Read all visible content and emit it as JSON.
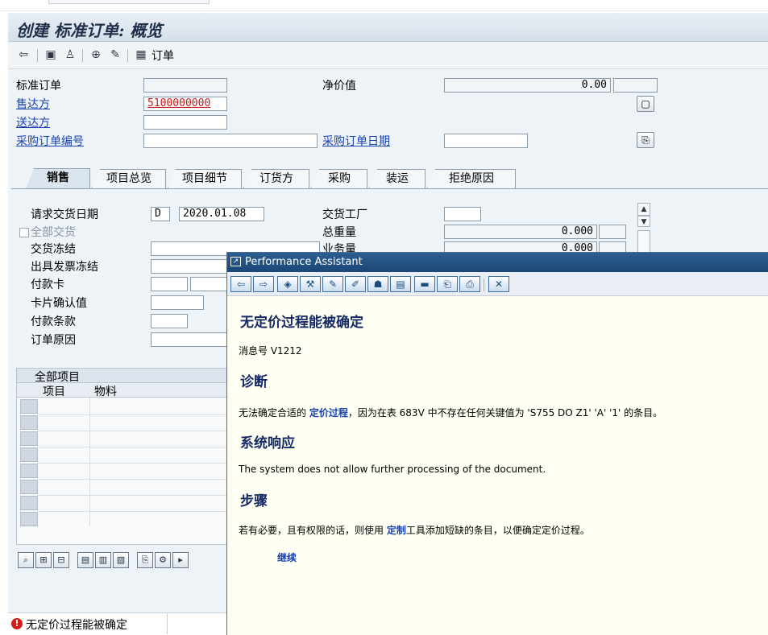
{
  "window": {
    "title": "创建 标准订单: 概览"
  },
  "toolbar": {
    "icons": [
      "back-icon",
      "save-icon",
      "user-icon",
      "display-icon",
      "edit-icon",
      "grid-icon"
    ],
    "order_label": "订单"
  },
  "header": {
    "order_type_label": "标准订单",
    "order_type_value": "",
    "sold_to_label": "售达方",
    "sold_to_value": "5100000000",
    "ship_to_label": "送达方",
    "ship_to_value": "",
    "po_number_label": "采购订单编号",
    "po_number_value": "",
    "net_value_label": "净价值",
    "net_value": "0.00",
    "net_value_currency": "",
    "po_date_label": "采购订单日期",
    "po_date_value": ""
  },
  "tabs": [
    {
      "label": "销售",
      "active": true
    },
    {
      "label": "项目总览"
    },
    {
      "label": "项目细节"
    },
    {
      "label": "订货方"
    },
    {
      "label": "采购"
    },
    {
      "label": "装运"
    },
    {
      "label": "拒绝原因"
    }
  ],
  "sales": {
    "req_delivery_label": "请求交货日期",
    "req_delivery_type": "D",
    "req_delivery_date": "2020.01.08",
    "complete_delivery_label": "全部交货",
    "delivery_block_label": "交货冻结",
    "billing_block_label": "出具发票冻结",
    "payment_card_label": "付款卡",
    "card_verification_label": "卡片确认值",
    "payment_terms_label": "付款条款",
    "order_reason_label": "订单原因",
    "delivering_plant_label": "交货工厂",
    "total_weight_label": "总重量",
    "total_weight_value": "0.000",
    "volume_label": "业务量",
    "volume_value": "0.000"
  },
  "items": {
    "title": "全部项目",
    "columns": [
      "项目",
      "物料"
    ]
  },
  "status": {
    "message": "无定价过程能被确定"
  },
  "assistant": {
    "title": "Performance Assistant",
    "heading": "无定价过程能被确定",
    "message_no": "消息号 V1212",
    "diag_heading": "诊断",
    "diag_pre": "无法确定合适的 ",
    "diag_kw": "定价过程",
    "diag_post": "，因为在表 683V 中不存在任何关键值为 'S755 DO Z1' 'A' '1' 的条目。",
    "response_heading": "系统响应",
    "response_text": "The system does not allow further processing of the document.",
    "steps_heading": "步骤",
    "steps_pre": "若有必要，且有权限的话，则使用 ",
    "steps_kw": "定制",
    "steps_post": "工具添加短缺的条目，以便确定定价过程。",
    "continue_label": "继续"
  }
}
